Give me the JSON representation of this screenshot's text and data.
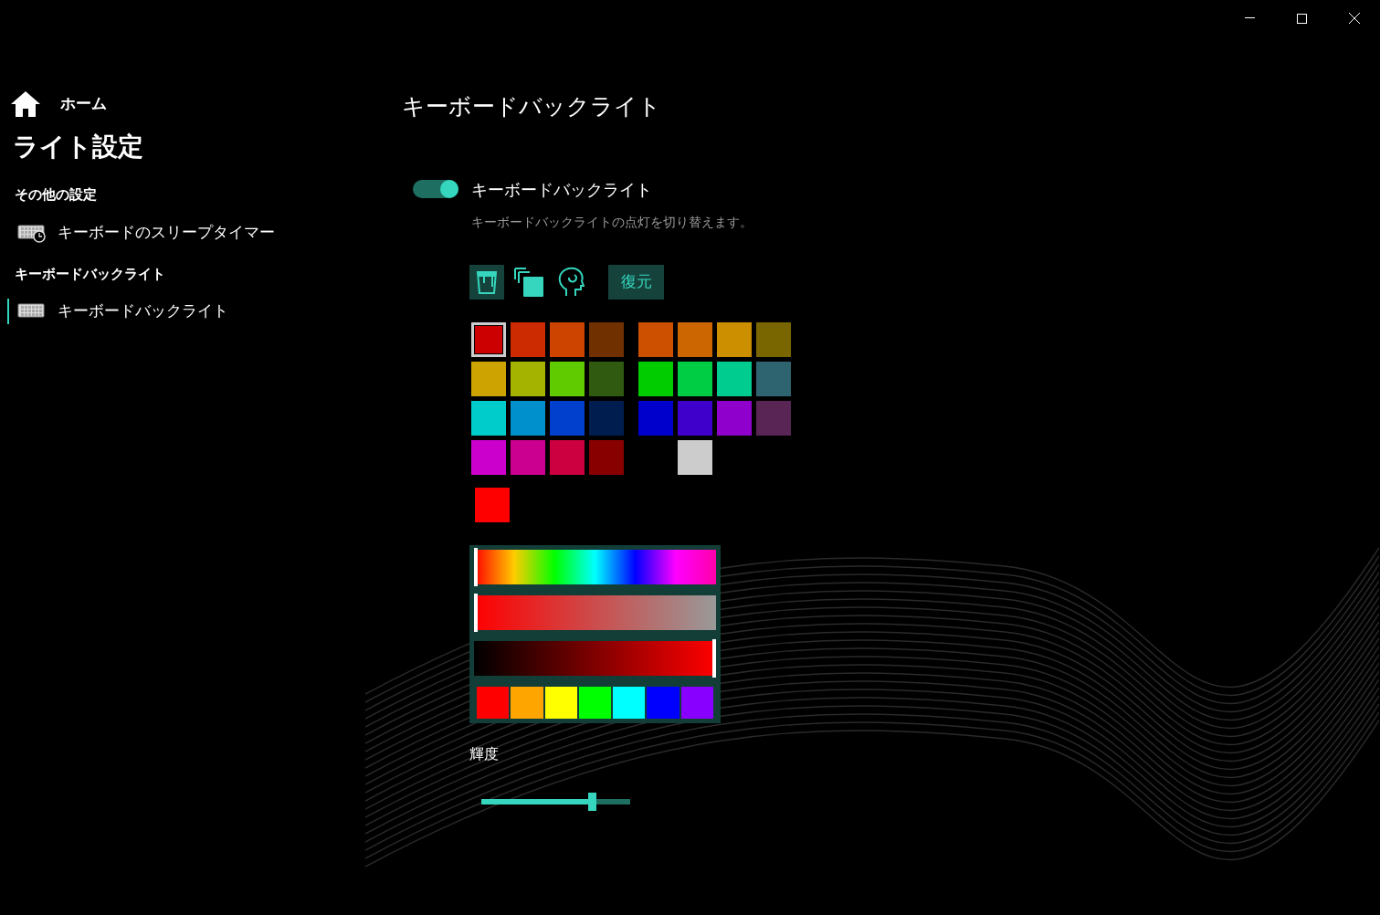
{
  "sidebar": {
    "home": "ホーム",
    "title": "ライト設定",
    "groups": [
      {
        "heading": "その他の設定",
        "items": [
          {
            "label": "キーボードのスリープタイマー",
            "kind": "timer",
            "selected": false
          }
        ]
      },
      {
        "heading": "キーボードバックライト",
        "items": [
          {
            "label": "キーボードバックライト",
            "kind": "keyboard",
            "selected": true
          }
        ]
      }
    ]
  },
  "page": {
    "title": "キーボードバックライト",
    "toggle": {
      "label": "キーボードバックライト",
      "on": true,
      "description": "キーボードバックライトの点灯を切り替えます。"
    },
    "modes": [
      {
        "kind": "paint",
        "selected": true
      },
      {
        "kind": "layers",
        "selected": false
      },
      {
        "kind": "head",
        "selected": false
      }
    ],
    "restore_button": "復元",
    "swatch_groups": [
      [
        {
          "kind": "swatch",
          "color": "#cc0000",
          "selected": true
        },
        {
          "kind": "swatch",
          "color": "#cc2a00",
          "selected": false
        },
        {
          "kind": "swatch",
          "color": "#cc4400",
          "selected": false
        },
        {
          "kind": "swatch",
          "color": "#703000",
          "selected": false
        },
        {
          "kind": "swatch",
          "color": "#cca300",
          "selected": false
        },
        {
          "kind": "swatch",
          "color": "#a3b300",
          "selected": false
        },
        {
          "kind": "swatch",
          "color": "#60cc00",
          "selected": false
        },
        {
          "kind": "swatch",
          "color": "#305a10",
          "selected": false
        },
        {
          "kind": "swatch",
          "color": "#00cccc",
          "selected": false
        },
        {
          "kind": "swatch",
          "color": "#0090cc",
          "selected": false
        },
        {
          "kind": "swatch",
          "color": "#0040cc",
          "selected": false
        },
        {
          "kind": "swatch",
          "color": "#001d50",
          "selected": false
        },
        {
          "kind": "swatch",
          "color": "#cc00cc",
          "selected": false
        },
        {
          "kind": "swatch",
          "color": "#cc0090",
          "selected": false
        },
        {
          "kind": "swatch",
          "color": "#cc0040",
          "selected": false
        },
        {
          "kind": "swatch",
          "color": "#880000",
          "selected": false
        }
      ],
      [
        {
          "kind": "swatch",
          "color": "#cc5000",
          "selected": false
        },
        {
          "kind": "swatch",
          "color": "#cc6600",
          "selected": false
        },
        {
          "kind": "swatch",
          "color": "#cc8f00",
          "selected": false
        },
        {
          "kind": "swatch",
          "color": "#7a6600",
          "selected": false
        },
        {
          "kind": "swatch",
          "color": "#00cc00",
          "selected": false
        },
        {
          "kind": "swatch",
          "color": "#00cc44",
          "selected": false
        },
        {
          "kind": "swatch",
          "color": "#00cc90",
          "selected": false
        },
        {
          "kind": "swatch",
          "color": "#2e6470",
          "selected": false
        },
        {
          "kind": "swatch",
          "color": "#0000cc",
          "selected": false
        },
        {
          "kind": "swatch",
          "color": "#4000cc",
          "selected": false
        },
        {
          "kind": "swatch",
          "color": "#9000cc",
          "selected": false
        },
        {
          "kind": "swatch",
          "color": "#582555",
          "selected": false
        },
        {
          "kind": "blank"
        },
        {
          "kind": "swatch",
          "color": "#cccccc",
          "selected": false
        },
        {
          "kind": "blank"
        },
        {
          "kind": "blank"
        }
      ]
    ],
    "current_color": {
      "color": "#ff0000"
    },
    "picker": {
      "hue": {
        "level": 0
      },
      "saturation": {
        "level": 0
      },
      "value": {
        "level": 1
      },
      "presets": [
        {
          "color": "#ff0000"
        },
        {
          "color": "#ffa500"
        },
        {
          "color": "#ffff00"
        },
        {
          "color": "#00ff00"
        },
        {
          "color": "#00ffff"
        },
        {
          "color": "#0000ff"
        },
        {
          "color": "#8800ff"
        }
      ]
    },
    "brightness": {
      "label": "輝度",
      "level": 0.74
    }
  }
}
